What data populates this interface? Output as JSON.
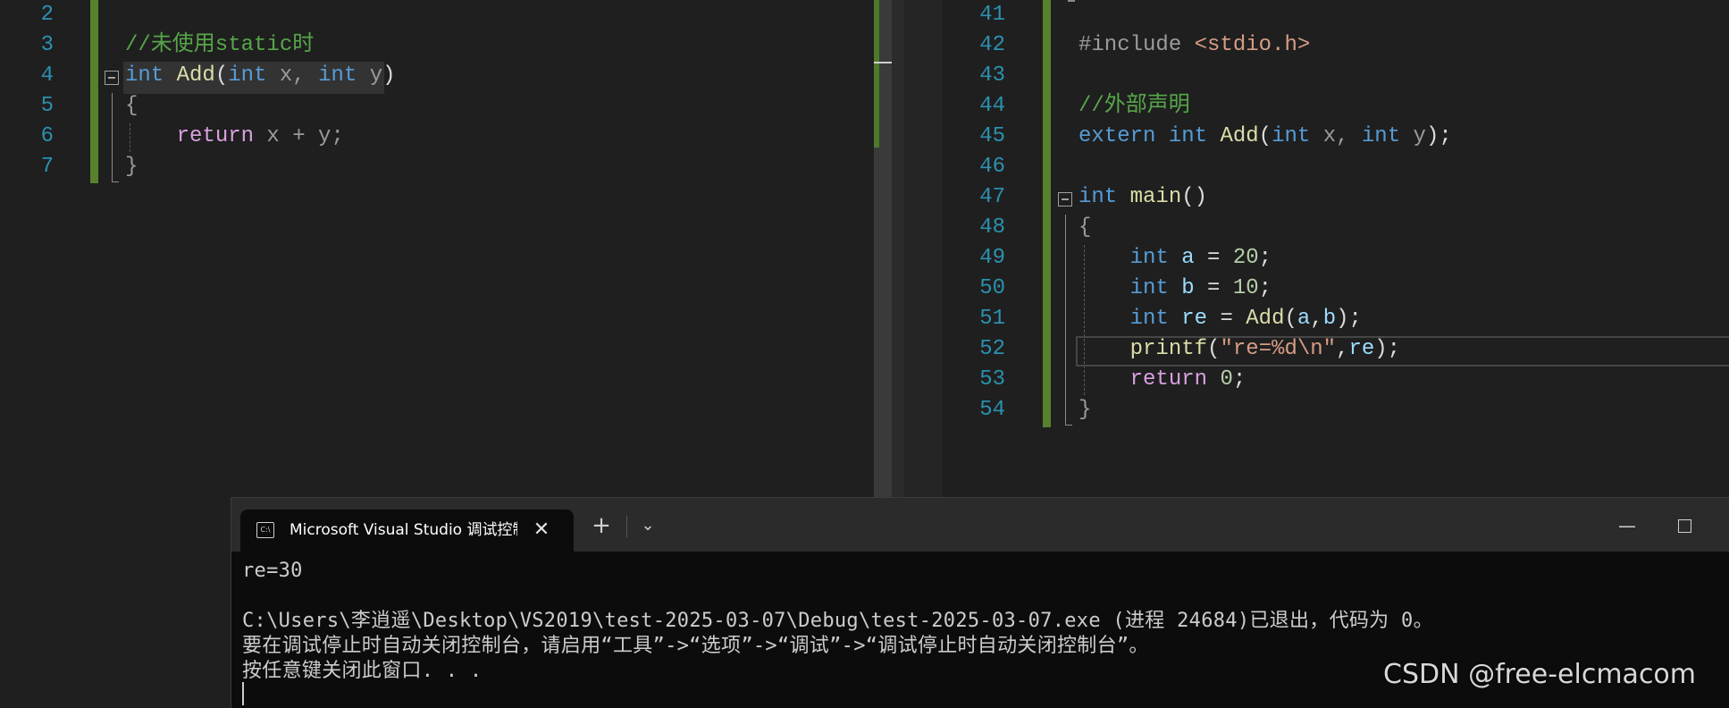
{
  "left_editor": {
    "lines": [
      {
        "num": "2",
        "parts": []
      },
      {
        "num": "3",
        "parts": [
          {
            "cls": "cm",
            "text": "//未使用static时"
          }
        ]
      },
      {
        "num": "4",
        "parts": [
          {
            "cls": "kw",
            "text": "int"
          },
          {
            "cls": "pl",
            "text": " "
          },
          {
            "cls": "fn",
            "text": "Add"
          },
          {
            "cls": "pl",
            "text": "("
          },
          {
            "cls": "kw",
            "text": "int"
          },
          {
            "cls": "dim",
            "text": " x, "
          },
          {
            "cls": "kw",
            "text": "int"
          },
          {
            "cls": "dim",
            "text": " y"
          },
          {
            "cls": "pl",
            "text": ")"
          }
        ]
      },
      {
        "num": "5",
        "parts": [
          {
            "cls": "dim",
            "text": "{"
          }
        ]
      },
      {
        "num": "6",
        "parts": [
          {
            "cls": "pl",
            "text": "    "
          },
          {
            "cls": "ret",
            "text": "return"
          },
          {
            "cls": "dim",
            "text": " x + y;"
          }
        ]
      },
      {
        "num": "7",
        "parts": [
          {
            "cls": "dim",
            "text": "}"
          }
        ]
      }
    ]
  },
  "right_editor": {
    "lines": [
      {
        "num": "41",
        "parts": []
      },
      {
        "num": "42",
        "parts": [
          {
            "cls": "pp",
            "text": "#include "
          },
          {
            "cls": "inc",
            "text": "<stdio.h>"
          }
        ]
      },
      {
        "num": "43",
        "parts": []
      },
      {
        "num": "44",
        "parts": [
          {
            "cls": "cm",
            "text": "//外部声明"
          }
        ]
      },
      {
        "num": "45",
        "parts": [
          {
            "cls": "kw",
            "text": "extern"
          },
          {
            "cls": "pl",
            "text": " "
          },
          {
            "cls": "kw",
            "text": "int"
          },
          {
            "cls": "pl",
            "text": " "
          },
          {
            "cls": "fn",
            "text": "Add"
          },
          {
            "cls": "pl",
            "text": "("
          },
          {
            "cls": "kw",
            "text": "int"
          },
          {
            "cls": "dim",
            "text": " x, "
          },
          {
            "cls": "kw",
            "text": "int"
          },
          {
            "cls": "dim",
            "text": " y"
          },
          {
            "cls": "pl",
            "text": ");"
          }
        ]
      },
      {
        "num": "46",
        "parts": []
      },
      {
        "num": "47",
        "parts": [
          {
            "cls": "kw",
            "text": "int"
          },
          {
            "cls": "pl",
            "text": " "
          },
          {
            "cls": "fn",
            "text": "main"
          },
          {
            "cls": "pl",
            "text": "()"
          }
        ]
      },
      {
        "num": "48",
        "parts": [
          {
            "cls": "dim",
            "text": "{"
          }
        ]
      },
      {
        "num": "49",
        "parts": [
          {
            "cls": "pl",
            "text": "    "
          },
          {
            "cls": "kw",
            "text": "int"
          },
          {
            "cls": "pl",
            "text": " "
          },
          {
            "cls": "var",
            "text": "a"
          },
          {
            "cls": "pl",
            "text": " = "
          },
          {
            "cls": "num",
            "text": "20"
          },
          {
            "cls": "pl",
            "text": ";"
          }
        ]
      },
      {
        "num": "50",
        "parts": [
          {
            "cls": "pl",
            "text": "    "
          },
          {
            "cls": "kw",
            "text": "int"
          },
          {
            "cls": "pl",
            "text": " "
          },
          {
            "cls": "var",
            "text": "b"
          },
          {
            "cls": "pl",
            "text": " = "
          },
          {
            "cls": "num",
            "text": "10"
          },
          {
            "cls": "pl",
            "text": ";"
          }
        ]
      },
      {
        "num": "51",
        "parts": [
          {
            "cls": "pl",
            "text": "    "
          },
          {
            "cls": "kw",
            "text": "int"
          },
          {
            "cls": "pl",
            "text": " "
          },
          {
            "cls": "var",
            "text": "re"
          },
          {
            "cls": "pl",
            "text": " = "
          },
          {
            "cls": "fn",
            "text": "Add"
          },
          {
            "cls": "pl",
            "text": "("
          },
          {
            "cls": "var",
            "text": "a"
          },
          {
            "cls": "pl",
            "text": ","
          },
          {
            "cls": "var",
            "text": "b"
          },
          {
            "cls": "pl",
            "text": ");"
          }
        ]
      },
      {
        "num": "52",
        "parts": [
          {
            "cls": "pl",
            "text": "    "
          },
          {
            "cls": "fn",
            "text": "printf"
          },
          {
            "cls": "pl",
            "text": "("
          },
          {
            "cls": "str",
            "text": "\"re=%d\\n\""
          },
          {
            "cls": "pl",
            "text": ","
          },
          {
            "cls": "var",
            "text": "re"
          },
          {
            "cls": "pl",
            "text": ");"
          }
        ]
      },
      {
        "num": "53",
        "parts": [
          {
            "cls": "pl",
            "text": "    "
          },
          {
            "cls": "ret",
            "text": "return"
          },
          {
            "cls": "pl",
            "text": " "
          },
          {
            "cls": "num",
            "text": "0"
          },
          {
            "cls": "pl",
            "text": ";"
          }
        ]
      },
      {
        "num": "54",
        "parts": [
          {
            "cls": "dim",
            "text": "}"
          }
        ]
      }
    ]
  },
  "terminal": {
    "tab_title": "Microsoft Visual Studio 调试控制台",
    "tab_icon_text": "C:\\",
    "close_glyph": "✕",
    "new_tab_glyph": "+",
    "dropdown_glyph": "⌄",
    "minimize_glyph": "—",
    "output_lines": [
      "re=30",
      "",
      "C:\\Users\\李逍遥\\Desktop\\VS2019\\test-2025-03-07\\Debug\\test-2025-03-07.exe (进程 24684)已退出，代码为 0。",
      "要在调试停止时自动关闭控制台，请启用“工具”->“选项”->“调试”->“调试停止时自动关闭控制台”。",
      "按任意键关闭此窗口. . ."
    ]
  },
  "watermark": "CSDN @free-elcmacom",
  "colors": {
    "editor_bg": "#1f1f1f",
    "keyword": "#569cd6",
    "function": "#dcdcaa",
    "comment": "#57a64a",
    "string": "#d69d85",
    "number": "#b5cea8",
    "change_bar": "#57812c",
    "terminal_bg": "#0c0c0c"
  }
}
